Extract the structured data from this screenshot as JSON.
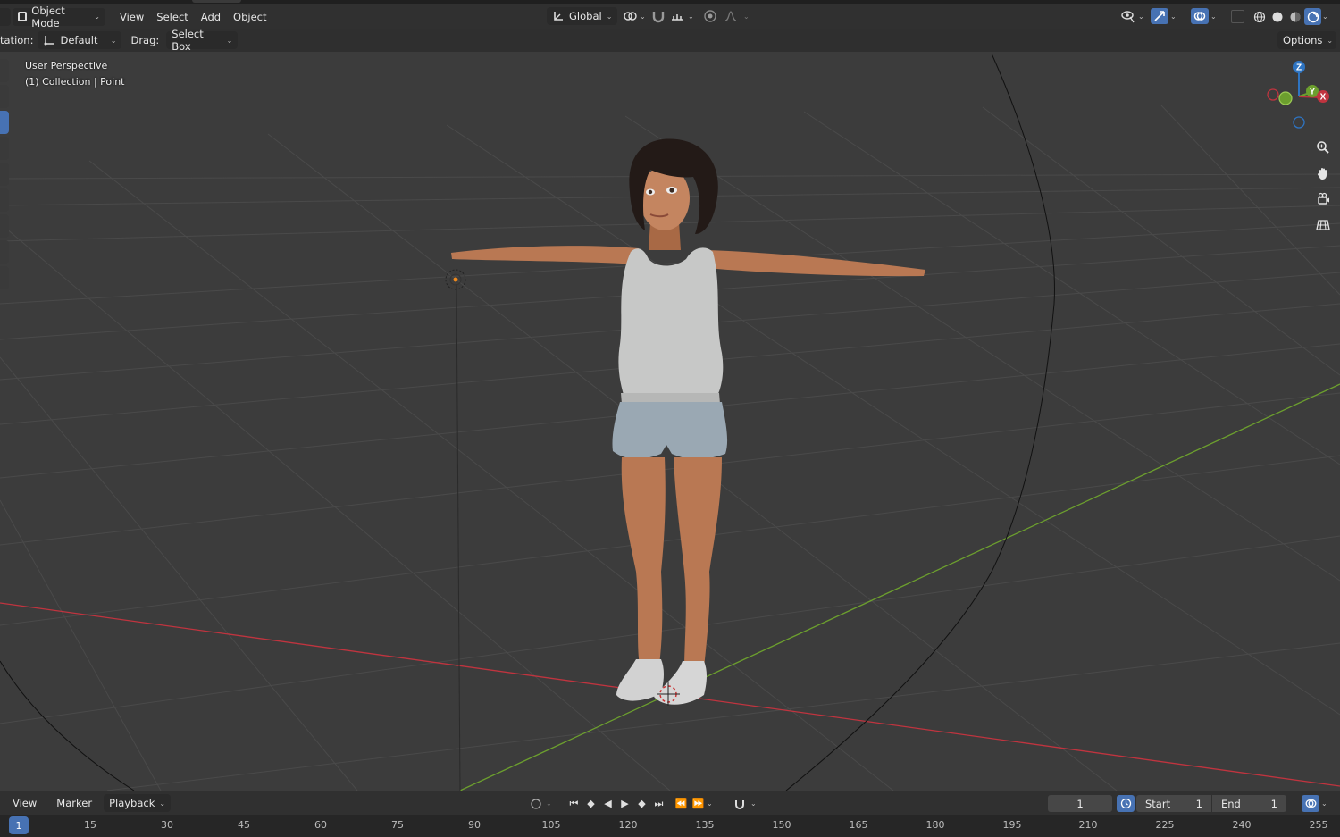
{
  "header": {
    "mode": "Object Mode",
    "menus": [
      "View",
      "Select",
      "Add",
      "Object"
    ],
    "transform_orientation": "Global"
  },
  "tool_header": {
    "orientation_label": "tation:",
    "orientation_value": "Default",
    "drag_label": "Drag:",
    "drag_value": "Select Box",
    "options_label": "Options"
  },
  "viewport": {
    "view_name": "User Perspective",
    "collection_info": "(1) Collection | Point",
    "gizmo_axes": {
      "z": "Z",
      "y": "Y",
      "x": "X"
    },
    "colors": {
      "x_axis": "#c0343f",
      "y_axis": "#6c9f2e",
      "z_axis": "#2e74c2",
      "grid": "#4a4a4a",
      "background": "#3c3c3c"
    }
  },
  "nav_icons": [
    "zoom-icon",
    "hand-pan-icon",
    "camera-icon",
    "grid-view-icon"
  ],
  "timeline": {
    "menus": [
      "View",
      "Marker",
      "Playback"
    ],
    "current_frame": "1",
    "start_label": "Start",
    "start_value": "1",
    "end_label": "End",
    "end_value": "1",
    "playhead": "1",
    "ruler_ticks": [
      "15",
      "30",
      "45",
      "60",
      "75",
      "90",
      "105",
      "120",
      "135",
      "150",
      "165",
      "180",
      "195",
      "210",
      "225",
      "240",
      "255"
    ]
  }
}
